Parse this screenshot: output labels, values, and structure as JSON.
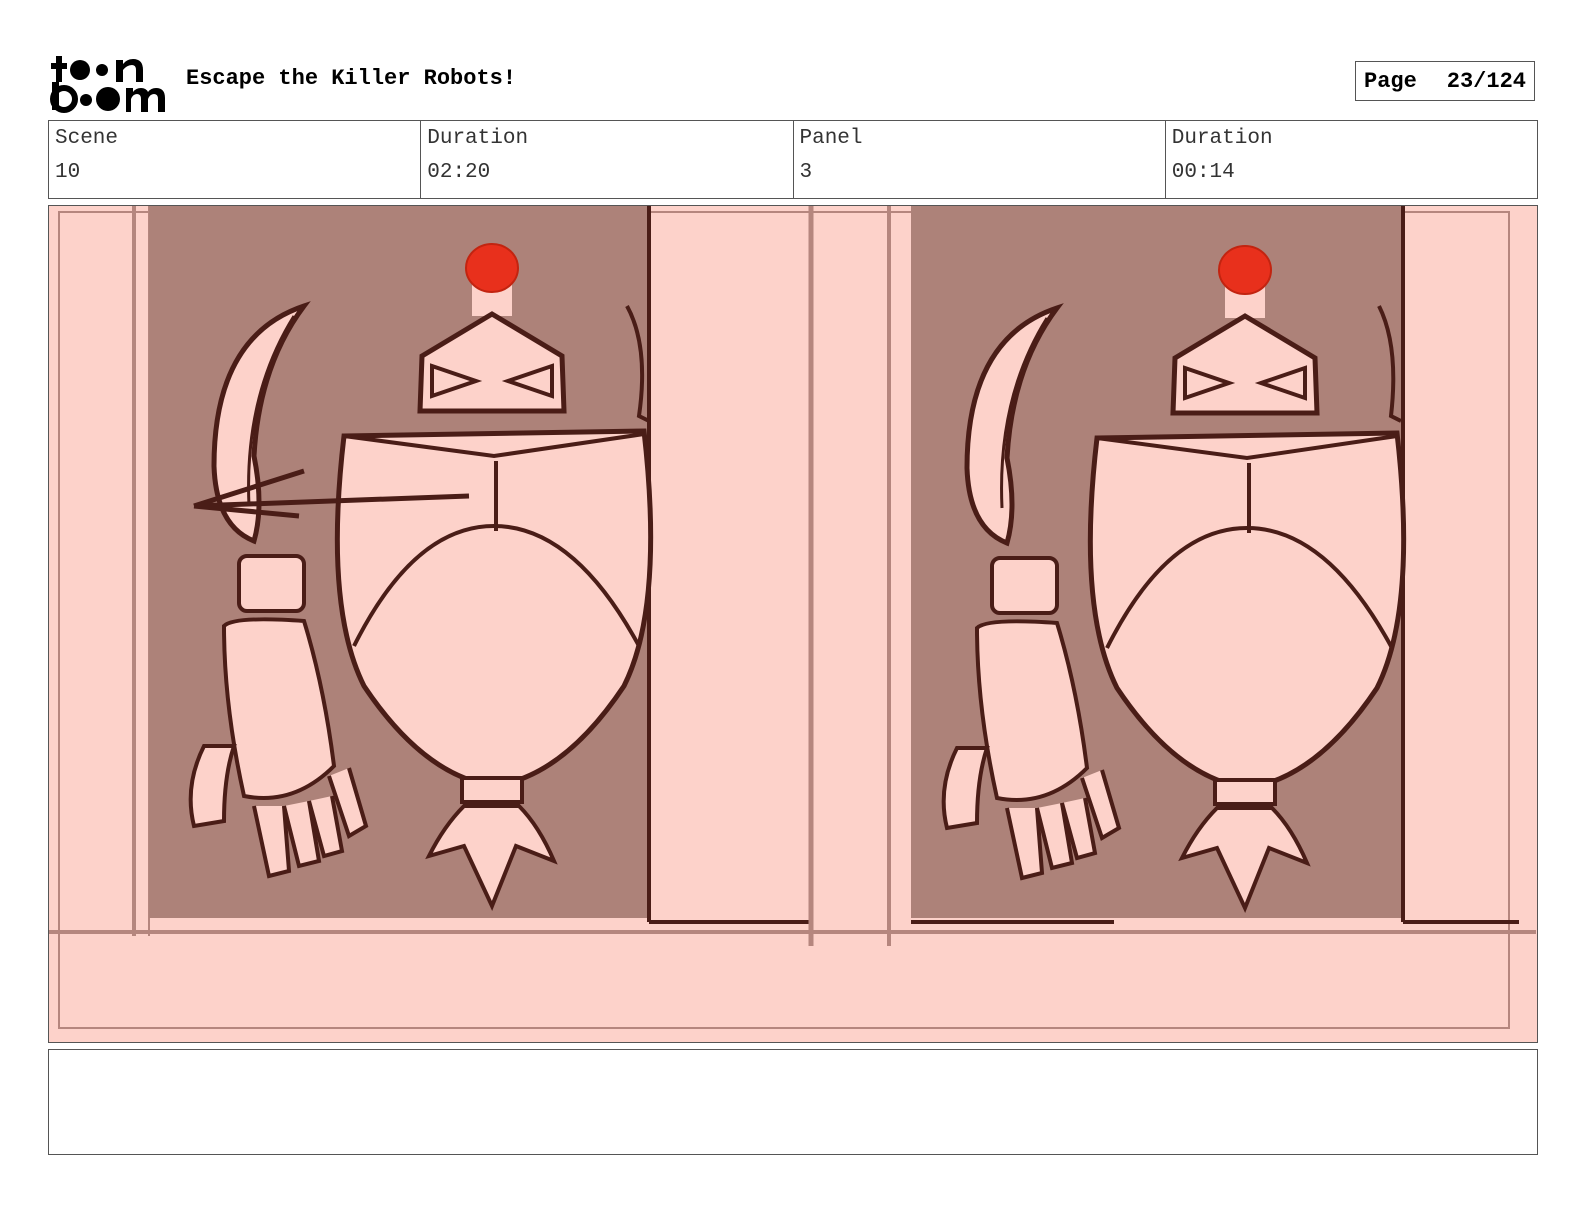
{
  "header": {
    "title": "Escape the Killer Robots!",
    "page_label": "Page",
    "page_value": "23/124"
  },
  "info": {
    "scene_label": "Scene",
    "scene_value": "10",
    "scene_duration_label": "Duration",
    "scene_duration_value": "02:20",
    "panel_label": "Panel",
    "panel_value": "3",
    "panel_duration_label": "Duration",
    "panel_duration_value": "00:14"
  },
  "notes": {
    "text": ""
  },
  "colors": {
    "panel_bg": "#fdd2ca",
    "wall_shadow": "#ad8279",
    "ink": "#4a1d17",
    "beacon": "#e8301c"
  }
}
